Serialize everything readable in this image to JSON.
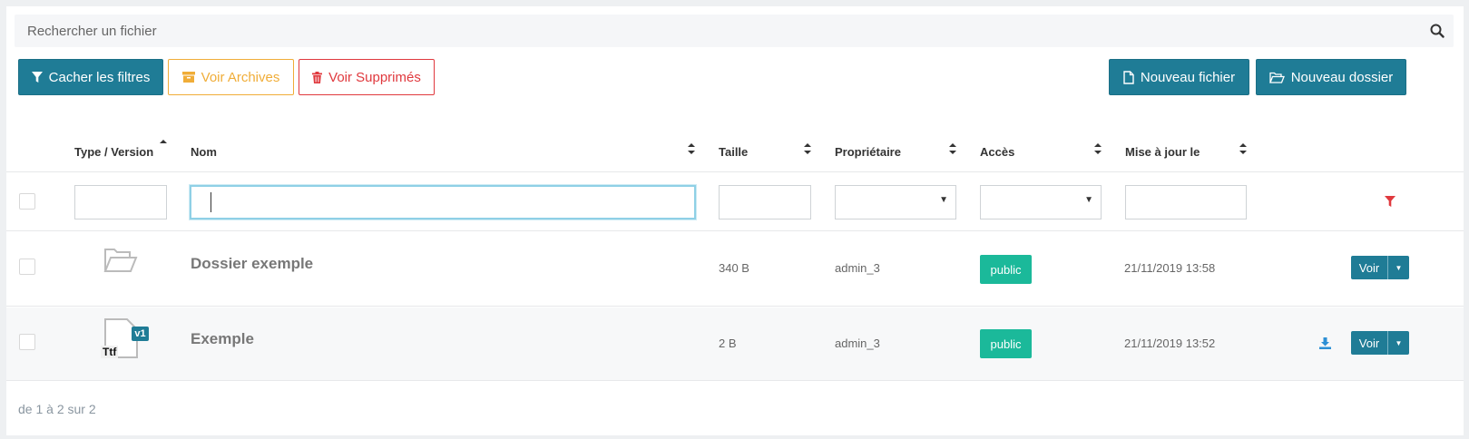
{
  "search": {
    "placeholder": "Rechercher un fichier",
    "icon": "search-icon"
  },
  "toolbar": {
    "hide_filters": "Cacher les filtres",
    "view_archives": "Voir Archives",
    "view_deleted": "Voir Supprimés",
    "new_file": "Nouveau fichier",
    "new_folder": "Nouveau dossier"
  },
  "columns": {
    "type": "Type / Version",
    "name": "Nom",
    "size": "Taille",
    "owner": "Propriétaire",
    "access": "Accès",
    "updated": "Mise à jour le"
  },
  "rows": [
    {
      "type_icon": "folder-icon",
      "name": "Dossier exemple",
      "size": "340 B",
      "owner": "admin_3",
      "access": "public",
      "updated": "21/11/2019 13:58",
      "action": "Voir"
    },
    {
      "type_icon": "file-icon",
      "version": "v1",
      "extension": "Ttf",
      "name": "Exemple",
      "size": "2 B",
      "owner": "admin_3",
      "access": "public",
      "updated": "21/11/2019 13:52",
      "action": "Voir"
    }
  ],
  "pagination": "de 1 à 2 sur 2",
  "colors": {
    "primary": "#1f7c96",
    "warning": "#f0ad38",
    "danger": "#e0393e",
    "badge": "#1bb99a"
  }
}
